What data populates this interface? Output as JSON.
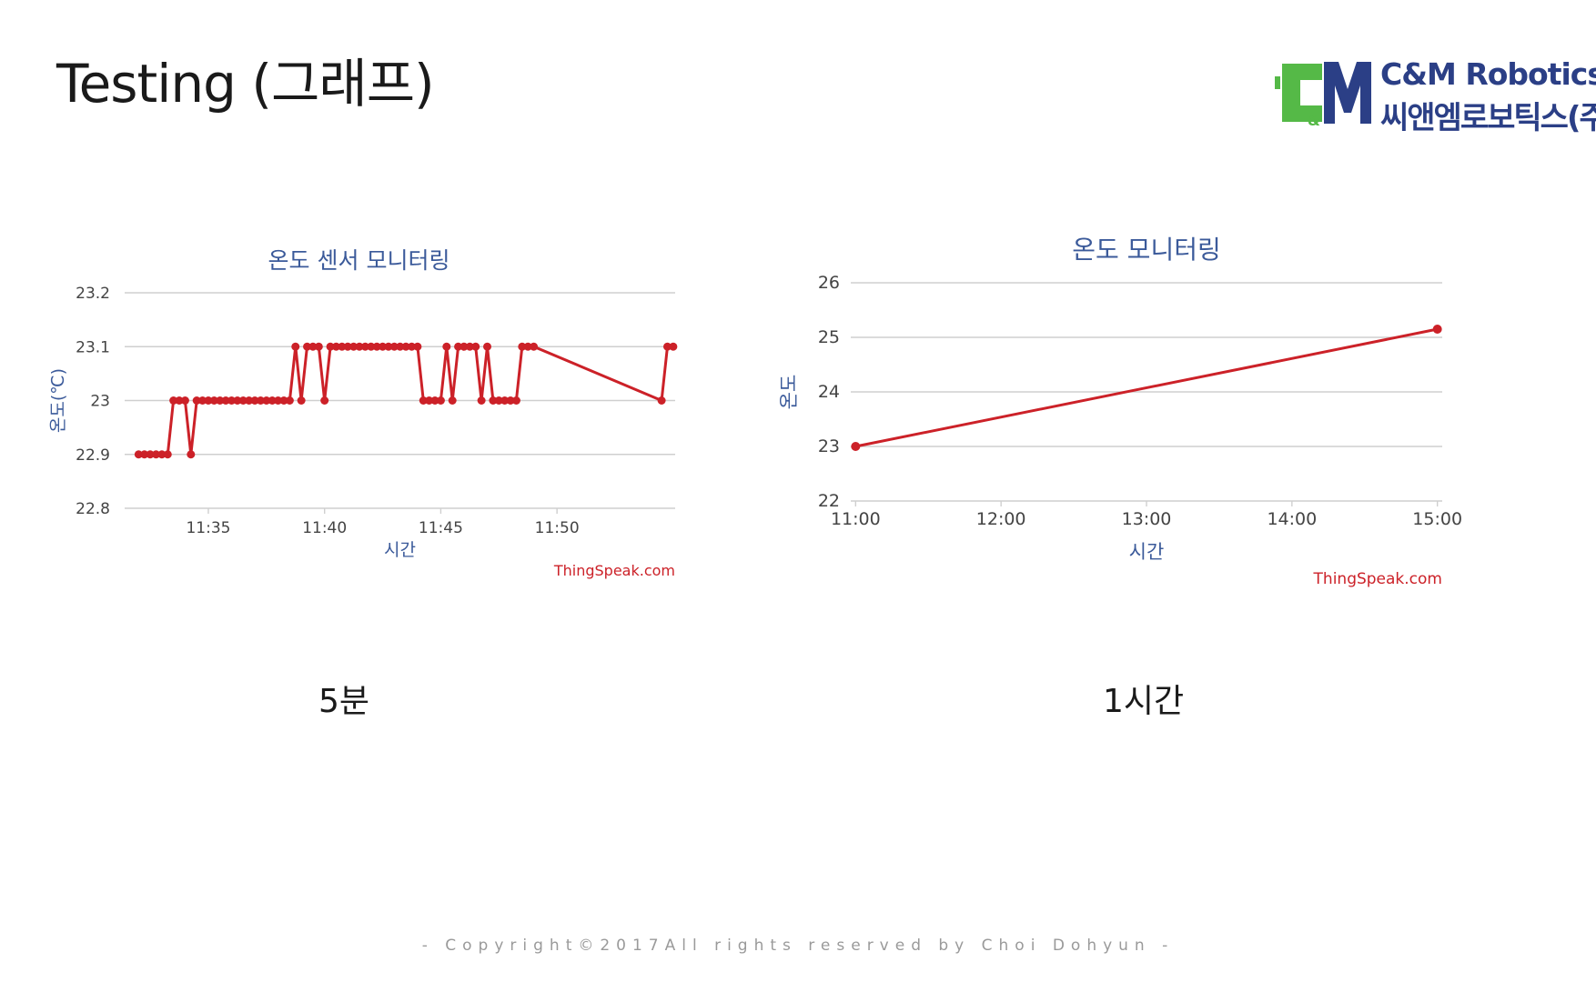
{
  "slide": {
    "title": "Testing (그래프)",
    "footer": "- Copyright©2017All rights reserved by Choi Dohyun -"
  },
  "logo": {
    "name_en": "C&M Robotics",
    "name_ko": "씨앤엠로보틱스(주)",
    "mark_text": "C&M",
    "colors": {
      "green": "#55b947",
      "navy": "#2b3f86"
    }
  },
  "captions": {
    "left": "5분",
    "right": "1시간"
  },
  "colors": {
    "series": "#cc2128",
    "grid": "#cfcfcf",
    "axis_title": "#3b5a9a",
    "tick": "#444444",
    "credit": "#cc2128"
  },
  "chart_data": [
    {
      "type": "line",
      "title": "온도 센서 모니터링",
      "xlabel": "시간",
      "ylabel": "온도(℃)",
      "ylim": [
        22.8,
        23.2
      ],
      "yticks": [
        "23.2",
        "23.1",
        "23",
        "22.9",
        "22.8"
      ],
      "xticks": [
        "11:35",
        "11:40",
        "11:45",
        "11:50"
      ],
      "credit": "ThingSpeak.com",
      "grid": true,
      "series": [
        {
          "x": [
            "11:32:00",
            "11:32:15",
            "11:32:30",
            "11:32:45",
            "11:33:00",
            "11:33:15",
            "11:33:30",
            "11:33:45",
            "11:34:00",
            "11:34:15",
            "11:34:30",
            "11:34:45",
            "11:35:00",
            "11:35:15",
            "11:35:30",
            "11:35:45",
            "11:36:00",
            "11:36:15",
            "11:36:30",
            "11:36:45",
            "11:37:00",
            "11:37:15",
            "11:37:30",
            "11:37:45",
            "11:38:00",
            "11:38:15",
            "11:38:30",
            "11:38:45",
            "11:39:00",
            "11:39:15",
            "11:39:30",
            "11:39:45",
            "11:40:00",
            "11:40:15",
            "11:40:30",
            "11:40:45",
            "11:41:00",
            "11:41:15",
            "11:41:30",
            "11:41:45",
            "11:42:00",
            "11:42:15",
            "11:42:30",
            "11:42:45",
            "11:43:00",
            "11:43:15",
            "11:43:30",
            "11:43:45",
            "11:44:00",
            "11:44:15",
            "11:44:30",
            "11:44:45",
            "11:45:00",
            "11:45:15",
            "11:45:30",
            "11:45:45",
            "11:46:00",
            "11:46:15",
            "11:46:30",
            "11:46:45",
            "11:47:00",
            "11:47:15",
            "11:47:30",
            "11:47:45",
            "11:48:00",
            "11:48:15",
            "11:48:30",
            "11:48:45",
            "11:49:00",
            "11:54:30",
            "11:54:45",
            "11:55:00"
          ],
          "y": [
            22.9,
            22.9,
            22.9,
            22.9,
            22.9,
            22.9,
            23.0,
            23.0,
            23.0,
            22.9,
            23.0,
            23.0,
            23.0,
            23.0,
            23.0,
            23.0,
            23.0,
            23.0,
            23.0,
            23.0,
            23.0,
            23.0,
            23.0,
            23.0,
            23.0,
            23.0,
            23.0,
            23.1,
            23.0,
            23.1,
            23.1,
            23.1,
            23.0,
            23.1,
            23.1,
            23.1,
            23.1,
            23.1,
            23.1,
            23.1,
            23.1,
            23.1,
            23.1,
            23.1,
            23.1,
            23.1,
            23.1,
            23.1,
            23.1,
            23.0,
            23.0,
            23.0,
            23.0,
            23.1,
            23.0,
            23.1,
            23.1,
            23.1,
            23.1,
            23.0,
            23.1,
            23.0,
            23.0,
            23.0,
            23.0,
            23.0,
            23.1,
            23.1,
            23.1,
            23.0,
            23.1,
            23.1
          ]
        }
      ]
    },
    {
      "type": "line",
      "title": "온도 모니터링",
      "xlabel": "시간",
      "ylabel": "온도",
      "ylim": [
        22,
        26
      ],
      "yticks": [
        "26",
        "25",
        "24",
        "23",
        "22"
      ],
      "xticks": [
        "11:00",
        "12:00",
        "13:00",
        "14:00",
        "15:00"
      ],
      "credit": "ThingSpeak.com",
      "grid": true,
      "series": [
        {
          "x": [
            "11:00",
            "15:00"
          ],
          "y": [
            23.0,
            25.15
          ]
        }
      ]
    }
  ]
}
